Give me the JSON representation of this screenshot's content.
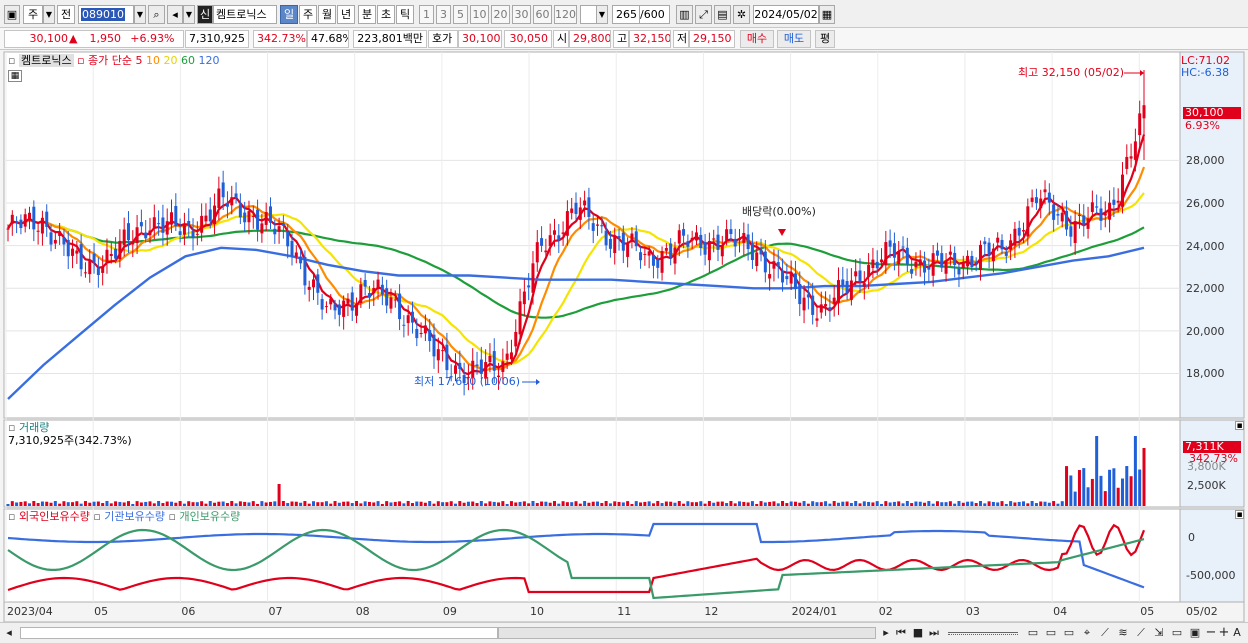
{
  "toolbar": {
    "market_label": "주",
    "prev_label": "전",
    "stock_code": "089010",
    "stock_badge": "신",
    "stock_name": "켐트로닉스",
    "period_buttons": [
      "일",
      "주",
      "월",
      "년",
      "분",
      "초",
      "틱"
    ],
    "interval_buttons": [
      "1",
      "3",
      "5",
      "10",
      "20",
      "30",
      "60",
      "120"
    ],
    "bar_count": "265",
    "bar_count_max": "/600",
    "date": "2024/05/02"
  },
  "info": {
    "price": "30,100",
    "change": "1,950",
    "change_pct": "+6.93%",
    "volume": "7,310,925",
    "volume_pct": "342.73%",
    "turnover_pct": "47.68%",
    "trade_value": "223,801백만",
    "quote_label": "호가",
    "quote1": "30,100",
    "quote2": "30,050",
    "open_label": "시",
    "open": "29,800",
    "high_label": "고",
    "high": "32,150",
    "low_label": "저",
    "low": "29,150",
    "buy_label": "매수",
    "sell_label": "매도",
    "eval_label": "평"
  },
  "price_panel": {
    "name": "켐트로닉스",
    "ma_title": "종가 단순",
    "ma_periods": [
      "5",
      "10",
      "20",
      "60",
      "120"
    ],
    "lc": "LC:71.02",
    "hc": "HC:-6.38",
    "current_price": "30,100",
    "current_pct": "6.93%",
    "high_note": "최고 32,150 (05/02)",
    "low_note": "최저 17,600 (10/06)",
    "dividend_note": "배당락(0.00%)",
    "y_ticks": [
      "28,000",
      "26,000",
      "24,000",
      "22,000",
      "20,000",
      "18,000"
    ],
    "y_tick_values": [
      28000,
      26000,
      24000,
      22000,
      20000,
      18000
    ]
  },
  "volume_panel": {
    "title": "거래량",
    "value": "7,310,925주(342.73%)",
    "current": "7,311K",
    "current_pct": "342.73%",
    "ticks": [
      "3,800K",
      "2,500K"
    ]
  },
  "holdings_panel": {
    "series": [
      "외국인보유수량",
      "기관보유수량",
      "개인보유수량"
    ],
    "ticks": [
      "0",
      "-500,000"
    ]
  },
  "x_axis": [
    "2023/04",
    "05",
    "06",
    "07",
    "08",
    "09",
    "10",
    "11",
    "12",
    "2024/01",
    "02",
    "03",
    "04",
    "05"
  ],
  "x_axis_right": "05/02",
  "colors": {
    "up": "#e0001b",
    "down": "#1f5fd8",
    "ma5": "#e0001b",
    "ma10": "#ff8c00",
    "ma20": "#f5e400",
    "ma60": "#1e9e3a",
    "ma120": "#3a6ee0",
    "foreign": "#e0001b",
    "institution": "#3a6ee0",
    "individual": "#3a9a6a"
  },
  "chart_data": {
    "type": "candlestick",
    "series": [
      {
        "name": "종가 단순 5",
        "values": [
          24800,
          25200,
          23000,
          23600,
          25200,
          24600,
          26100,
          25400,
          24000,
          20700,
          22000,
          21200,
          19000,
          17900,
          18600,
          24000,
          25700,
          24400,
          23400,
          24100,
          24300,
          23900,
          22100,
          20900,
          22800,
          23700,
          23000,
          23400,
          23800,
          26200,
          25000,
          25600,
          30100
        ]
      },
      {
        "name": "종가 단순 120",
        "values": [
          16800,
          18400,
          19800,
          21200,
          22500,
          23500,
          23900,
          23800,
          23500,
          23100,
          22800,
          22600,
          22600,
          22600,
          22500,
          22400,
          22400,
          22400,
          22300,
          22200,
          22100,
          22000,
          22000,
          22100,
          22100,
          22200,
          22300,
          22500,
          22700,
          23000,
          23300,
          23500,
          23900
        ]
      }
    ],
    "price_high": 32150,
    "price_high_date": "05/02",
    "price_low": 17600,
    "price_low_date": "10/06"
  }
}
